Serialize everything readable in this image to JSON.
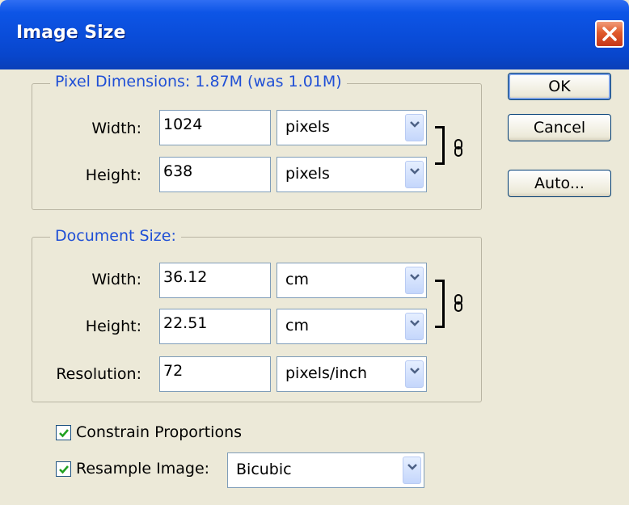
{
  "window": {
    "title": "Image Size"
  },
  "pixel_dimensions": {
    "title": "Pixel Dimensions:  1.87M (was 1.01M)",
    "width": {
      "label": "Width:",
      "value": "1024",
      "unit": "pixels"
    },
    "height": {
      "label": "Height:",
      "value": "638",
      "unit": "pixels"
    }
  },
  "document_size": {
    "title": "Document Size:",
    "width": {
      "label": "Width:",
      "value": "36.12",
      "unit": "cm"
    },
    "height": {
      "label": "Height:",
      "value": "22.51",
      "unit": "cm"
    },
    "resolution": {
      "label": "Resolution:",
      "value": "72",
      "unit": "pixels/inch"
    }
  },
  "buttons": {
    "ok": "OK",
    "cancel": "Cancel",
    "auto": "Auto..."
  },
  "options": {
    "constrain": {
      "label": "Constrain Proportions",
      "checked": true
    },
    "resample": {
      "label": "Resample Image:",
      "checked": true,
      "method": "Bicubic"
    }
  },
  "colors": {
    "titlebar": "#0a4cd8",
    "group_title": "#1f4fd6",
    "face": "#ece9d8",
    "check": "#21a121"
  },
  "icons": {
    "close": "close-icon",
    "dropdown": "chevron-down-icon",
    "link": "chain-link-icon",
    "check": "checkmark-icon"
  }
}
